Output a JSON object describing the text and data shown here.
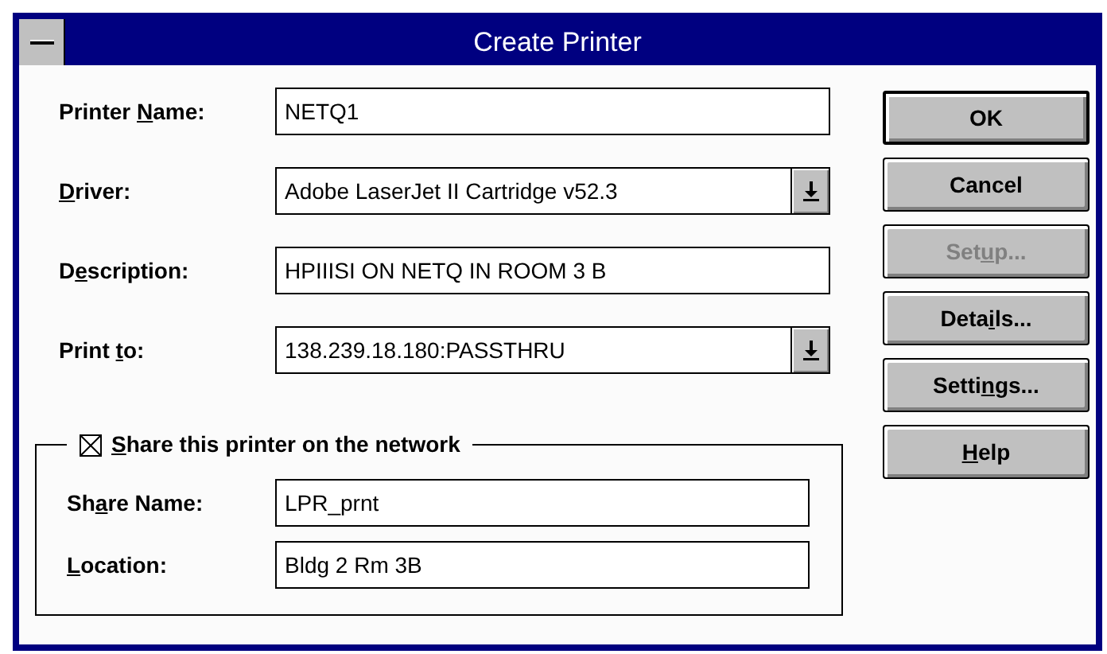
{
  "window": {
    "title": "Create Printer"
  },
  "fields": [
    {
      "kind": "text",
      "label": {
        "pre": "Printer ",
        "key": "N",
        "post": "ame:"
      },
      "value": "NETQ1"
    },
    {
      "kind": "dropdown",
      "label": {
        "key": "D",
        "post": "river:"
      },
      "value": "Adobe LaserJet II Cartridge v52.3"
    },
    {
      "kind": "text",
      "label": {
        "pre": "D",
        "key": "e",
        "post": "scription:"
      },
      "value": "HPIIISI ON NETQ IN ROOM 3 B"
    },
    {
      "kind": "dropdown",
      "label": {
        "pre": "Print ",
        "key": "t",
        "post": "o:"
      },
      "value": "138.239.18.180:PASSTHRU"
    }
  ],
  "share": {
    "checked": true,
    "label": {
      "key": "S",
      "post": "hare this printer on the network"
    },
    "fields": [
      {
        "label": {
          "pre": "Sh",
          "key": "a",
          "post": "re Name:"
        },
        "value": "LPR_prnt"
      },
      {
        "label": {
          "key": "L",
          "post": "ocation:"
        },
        "value": "Bldg 2 Rm 3B"
      }
    ]
  },
  "buttons": [
    {
      "label": {
        "post": "OK"
      },
      "default": true,
      "disabled": false
    },
    {
      "label": {
        "post": "Cancel"
      },
      "default": false,
      "disabled": false
    },
    {
      "label": {
        "pre": "Set",
        "key": "u",
        "post": "p..."
      },
      "default": false,
      "disabled": true
    },
    {
      "label": {
        "pre": "Deta",
        "key": "i",
        "post": "ls..."
      },
      "default": false,
      "disabled": false
    },
    {
      "label": {
        "pre": "Setti",
        "key": "n",
        "post": "gs..."
      },
      "default": false,
      "disabled": false
    },
    {
      "label": {
        "key": "H",
        "post": "elp"
      },
      "default": false,
      "disabled": false
    }
  ]
}
